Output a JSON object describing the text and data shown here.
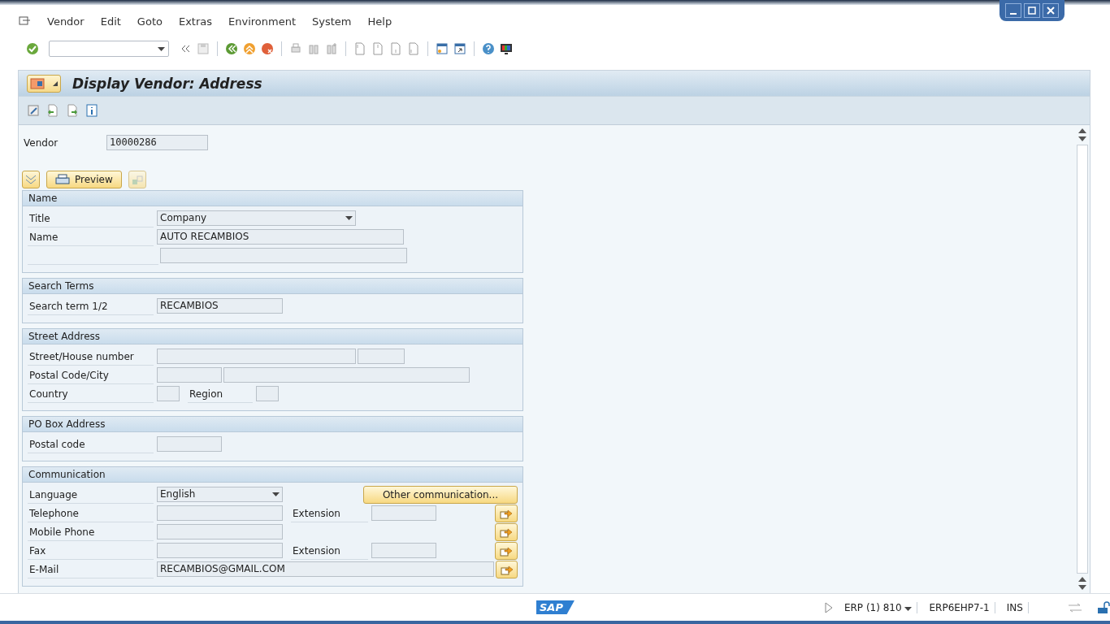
{
  "menu": [
    "Vendor",
    "Edit",
    "Goto",
    "Extras",
    "Environment",
    "System",
    "Help"
  ],
  "title": "Display Vendor: Address",
  "vendor": {
    "label": "Vendor",
    "value": "10000286"
  },
  "preview_button": "Preview",
  "sections": [
    {
      "title": "Name",
      "rows": [
        {
          "items": [
            {
              "kind": "label",
              "text": "Title"
            },
            {
              "kind": "dropdown",
              "value": "Company"
            }
          ]
        },
        {
          "items": [
            {
              "kind": "label",
              "text": "Name"
            },
            {
              "kind": "field",
              "value": "AUTO RECAMBIOS"
            }
          ]
        },
        {
          "items": [
            {
              "kind": "blank"
            },
            {
              "kind": "field"
            }
          ]
        }
      ]
    },
    {
      "title": "Search Terms",
      "rows": [
        {
          "items": [
            {
              "kind": "label",
              "text": "Search term 1/2"
            },
            {
              "kind": "field",
              "value": "RECAMBIOS"
            }
          ]
        }
      ]
    },
    {
      "title": "Street Address",
      "rows": [
        {
          "items": [
            {
              "kind": "label",
              "text": "Street/House number"
            },
            {
              "kind": "field"
            },
            {
              "kind": "field"
            }
          ]
        },
        {
          "items": [
            {
              "kind": "label",
              "text": "Postal Code/City"
            },
            {
              "kind": "field"
            },
            {
              "kind": "field"
            }
          ]
        },
        {
          "items": [
            {
              "kind": "label",
              "text": "Country"
            },
            {
              "kind": "field"
            },
            {
              "kind": "sublabel",
              "text": "Region"
            },
            {
              "kind": "field"
            }
          ]
        }
      ]
    },
    {
      "title": "PO Box Address",
      "rows": [
        {
          "items": [
            {
              "kind": "label",
              "text": "Postal code"
            },
            {
              "kind": "field"
            }
          ]
        }
      ]
    },
    {
      "title": "Communication",
      "rows": [
        {
          "items": [
            {
              "kind": "label",
              "text": "Language"
            },
            {
              "kind": "dropdown",
              "value": "English"
            },
            {
              "kind": "button",
              "text": "Other communication..."
            }
          ]
        },
        {
          "items": [
            {
              "kind": "label",
              "text": "Telephone"
            },
            {
              "kind": "field"
            },
            {
              "kind": "sublabel",
              "text": "Extension"
            },
            {
              "kind": "field"
            },
            {
              "kind": "action"
            }
          ]
        },
        {
          "items": [
            {
              "kind": "label",
              "text": "Mobile Phone"
            },
            {
              "kind": "field"
            },
            {
              "kind": "action"
            }
          ]
        },
        {
          "items": [
            {
              "kind": "label",
              "text": "Fax"
            },
            {
              "kind": "field"
            },
            {
              "kind": "sublabel",
              "text": "Extension"
            },
            {
              "kind": "field"
            },
            {
              "kind": "action"
            }
          ]
        },
        {
          "items": [
            {
              "kind": "label",
              "text": "E-Mail"
            },
            {
              "kind": "field",
              "value": "RECAMBIOS@GMAIL.COM"
            },
            {
              "kind": "action"
            }
          ]
        }
      ]
    }
  ],
  "status_bar": {
    "logo": "SAP",
    "system": "ERP (1) 810",
    "server": "ERP6EHP7-1",
    "mode": "INS"
  }
}
